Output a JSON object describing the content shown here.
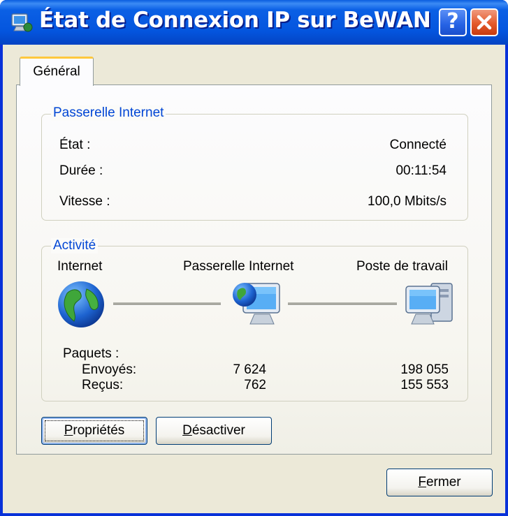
{
  "window": {
    "title": "État de Connexion IP sur BeWAN",
    "help_label": "?"
  },
  "tabs": [
    {
      "label": "Général"
    }
  ],
  "gateway": {
    "legend": "Passerelle Internet",
    "rows": [
      {
        "label": "État :",
        "value": "Connecté"
      },
      {
        "label": "Durée :",
        "value": "00:11:54"
      },
      {
        "label": "Vitesse :",
        "value": "100,0 Mbits/s"
      }
    ]
  },
  "activity": {
    "legend": "Activité",
    "nodes": [
      {
        "label": "Internet",
        "icon": "globe-icon"
      },
      {
        "label": "Passerelle Internet",
        "icon": "gateway-computer-icon"
      },
      {
        "label": "Poste de travail",
        "icon": "workstation-computer-icon"
      }
    ],
    "packets_label": "Paquets :",
    "sent": {
      "label": "Envoyés:",
      "gateway": "7 624",
      "workstation": "198 055"
    },
    "received": {
      "label": "Reçus:",
      "gateway": "762",
      "workstation": "155 553"
    }
  },
  "buttons": {
    "properties": {
      "mnemonic": "P",
      "rest": "ropriétés"
    },
    "disable": {
      "mnemonic": "D",
      "rest": "ésactiver"
    },
    "close": {
      "mnemonic": "F",
      "rest": "ermer"
    }
  }
}
